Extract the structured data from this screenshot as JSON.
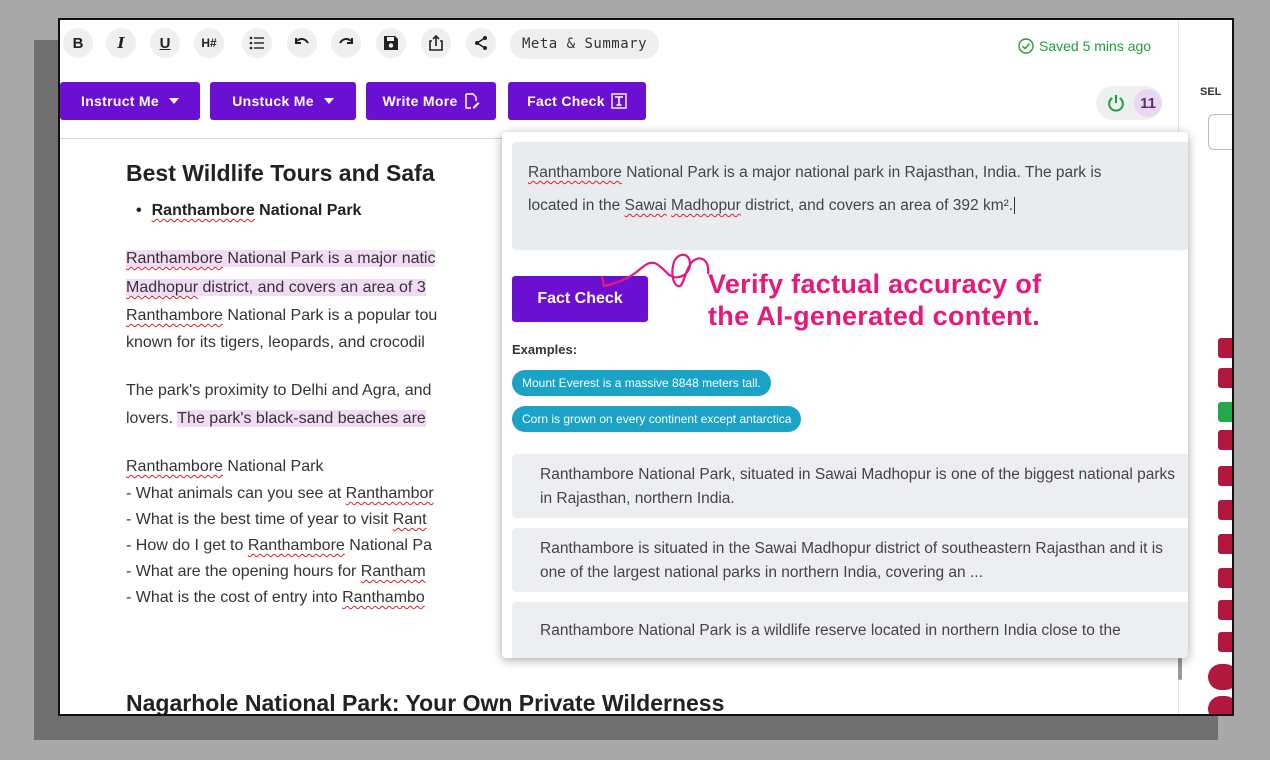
{
  "toolbar": {
    "bold": "B",
    "italic": "I",
    "underline": "U",
    "heading": "H#",
    "meta_summary": "Meta & Summary",
    "saved_status": "Saved 5 mins ago"
  },
  "actions": {
    "instruct": "Instruct Me",
    "unstuck": "Unstuck Me",
    "write_more": "Write More",
    "fact_check": "Fact Check"
  },
  "power": {
    "count": "11"
  },
  "right_panel": {
    "select_label": "SEL"
  },
  "article": {
    "title": "Best Wildlife Tours and Safa",
    "bullet": "Ranthambore",
    "bullet_rest": " National Park",
    "p1_l1a": "Ranthambore",
    "p1_l1b": " National Park is a major natic",
    "p1_l2a": "Madhopur",
    "p1_l2b": " district, and covers an area of 3",
    "p1_l3a": "Ranthambore",
    "p1_l3b": " National Park is a popular tou",
    "p1_l4": "known for its tigers, leopards, and crocodil",
    "p2_l1": "The park's proximity to Delhi and Agra, and",
    "p2_l2a": "lovers. ",
    "p2_l2b": "The park's black-sand beaches are",
    "list_head_a": "Ranthambore",
    "list_head_b": " National Park",
    "q1a": "- What animals can you see at ",
    "q1b": "Ranthambor",
    "q2a": "- What is the best time of year to visit ",
    "q2b": "Rant",
    "q3a": "- How do I get to ",
    "q3b": "Ranthambore",
    "q3c": " National Pa",
    "q4a": "- What are the opening hours for ",
    "q4b": "Rantham",
    "q5a": "- What is the cost of entry into ",
    "q5b": "Ranthambo",
    "h2": "Nagarhole National Park: Your Own Private Wilderness"
  },
  "fact_check_popup": {
    "input_a": "Ranthambore",
    "input_b": " National Park is a major national park in Rajasthan, India. The park is",
    "input_c": "located in the ",
    "input_d": "Sawai",
    "input_e": " ",
    "input_f": "Madhopur",
    "input_g": " district, and covers an area of 392 km².",
    "button": "Fact Check",
    "examples_label": "Examples:",
    "examples": [
      "Mount Everest is a massive 8848 meters tall.",
      "Corn is grown on every continent except antarctica"
    ],
    "results": [
      "Ranthambore National Park, situated in Sawai Madhopur is one of the biggest national parks in Rajasthan, northern India.",
      "Ranthambore is situated in the Sawai Madhopur district of southeastern Rajasthan and it is one of the largest national parks in northern India, covering an ...",
      "Ranthambore National Park is a wildlife reserve located in northern India close to the"
    ]
  },
  "annotation": {
    "line1": "Verify factual accuracy of",
    "line2": "the AI-generated content."
  },
  "colors": {
    "accent": "#6b0fd3",
    "annotation": "#e6197a",
    "chip": "#1aa3c6",
    "saved": "#1e9e3d",
    "highlight": "#f2dcf5"
  }
}
